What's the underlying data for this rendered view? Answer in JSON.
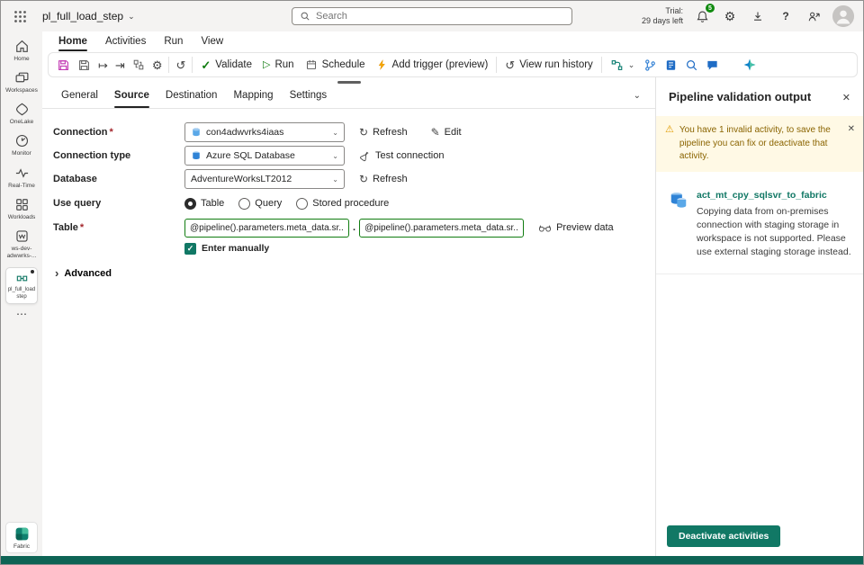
{
  "icons": {
    "chevron_down": "⌄",
    "gear": "⚙",
    "help": "?",
    "undo": "↺",
    "history": "↺",
    "arrow_from_bar": "↦",
    "arrow_to_bar": "⇥",
    "validate_check": "✓",
    "run_play": "▷",
    "refresh": "↻",
    "edit_pencil": "✎",
    "close": "✕",
    "warning": "⚠",
    "more": "⋯",
    "advanced_chevron": "›",
    "dot_separator": "."
  },
  "topbar": {
    "title": "pl_full_load_step",
    "search_placeholder": "Search",
    "trial_label": "Trial:",
    "trial_days": "29 days left",
    "notification_count": "5"
  },
  "menubar": {
    "tabs": [
      {
        "label": "Home",
        "active": true
      },
      {
        "label": "Activities",
        "active": false
      },
      {
        "label": "Run",
        "active": false
      },
      {
        "label": "View",
        "active": false
      }
    ]
  },
  "toolbar": {
    "validate_label": "Validate",
    "run_label": "Run",
    "schedule_label": "Schedule",
    "add_trigger_label": "Add trigger (preview)",
    "view_run_history_label": "View run history"
  },
  "sidebar": {
    "items": [
      {
        "label": "Home"
      },
      {
        "label": "Workspaces"
      },
      {
        "label": "OneLake"
      },
      {
        "label": "Monitor"
      },
      {
        "label": "Real-Time"
      },
      {
        "label": "Workloads"
      },
      {
        "label": "ws-dev-adwwrks-..."
      }
    ],
    "selected_item_label": "pl_full_load step",
    "fabric_label": "Fabric"
  },
  "editor": {
    "tabs": [
      "General",
      "Source",
      "Destination",
      "Mapping",
      "Settings"
    ],
    "active_tab": "Source",
    "required_marker": "*",
    "fields": {
      "connection_label": "Connection",
      "connection_value": "con4adwvrks4iaas",
      "refresh_label": "Refresh",
      "edit_label": "Edit",
      "connection_type_label": "Connection type",
      "connection_type_value": "Azure SQL Database",
      "test_connection_label": "Test connection",
      "database_label": "Database",
      "database_value": "AdventureWorksLT2012",
      "use_query_label": "Use query",
      "use_query_options": [
        "Table",
        "Query",
        "Stored procedure"
      ],
      "use_query_selected": "Table",
      "table_label": "Table",
      "table_schema_value": "@pipeline().parameters.meta_data.sr...",
      "table_name_value": "@pipeline().parameters.meta_data.sr...",
      "preview_data_label": "Preview data",
      "enter_manually_label": "Enter manually",
      "advanced_label": "Advanced"
    }
  },
  "validation_panel": {
    "title": "Pipeline validation output",
    "warning_text": "You have 1 invalid activity, to save the pipeline you can fix or deactivate that activity.",
    "activity_name": "act_mt_cpy_sqlsvr_to_fabric",
    "activity_description": "Copying data from on-premises connection with staging storage in workspace is not supported. Please use external staging storage instead.",
    "deactivate_button_label": "Deactivate activities"
  },
  "colors": {
    "accent_teal": "#117865",
    "warning_bg": "#fff9e5",
    "warning_icon": "#eaa300",
    "valid_green": "#107c10",
    "save_magenta": "#c239b3",
    "icon_blue": "#1f6cc5",
    "bottom_bar": "#0e6455"
  }
}
